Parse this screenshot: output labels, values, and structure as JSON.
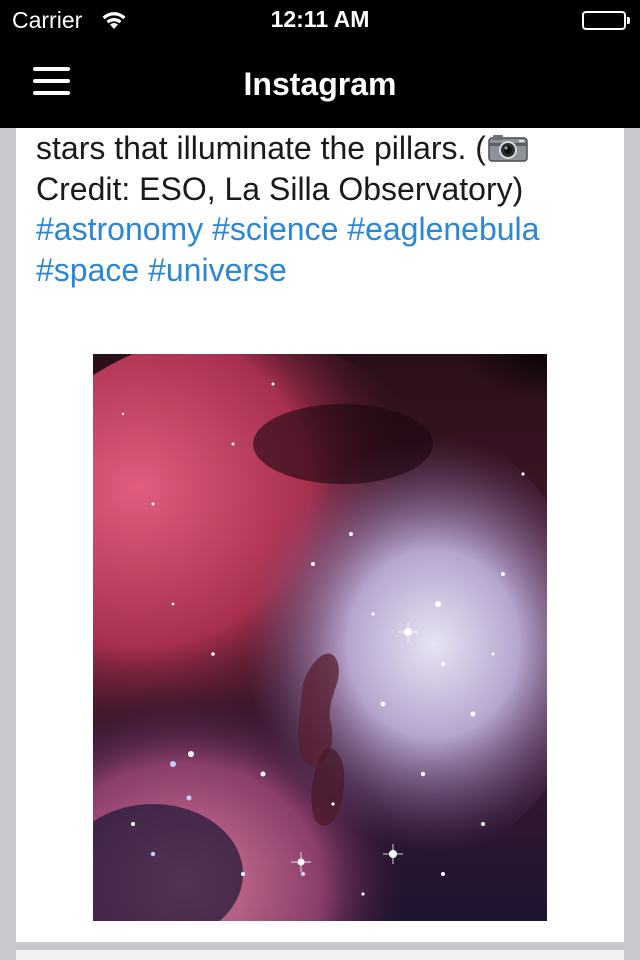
{
  "status_bar": {
    "carrier": "Carrier",
    "time": "12:11 AM",
    "wifi_icon": "wifi-icon",
    "battery_icon": "battery-icon"
  },
  "nav": {
    "title": "Instagram",
    "menu_icon": "hamburger-menu-icon"
  },
  "post": {
    "caption_line1": "stars that illuminate the pillars. (",
    "caption_line2": "Credit: ESO, La Silla Observatory)",
    "hashtags": [
      "#astronomy",
      "#science",
      "#eaglenebula",
      "#space",
      "#universe"
    ],
    "camera_icon": "camera-emoji-icon",
    "image_subject": "eagle-nebula-photo"
  },
  "colors": {
    "nav_background": "#000000",
    "hashtag": "#2a86d6",
    "page_background": "#c8c9cd",
    "card_background": "#ffffff"
  }
}
